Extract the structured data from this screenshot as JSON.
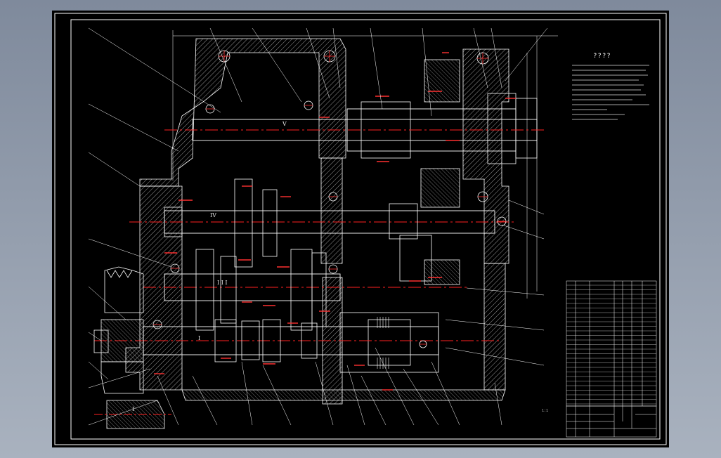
{
  "window": {
    "background": "#8b95a6"
  },
  "drawing": {
    "type": "gearbox-assembly-cross-section",
    "notes_title": "????",
    "shaft_labels": [
      "V",
      "IV",
      "I I I",
      "I",
      "I"
    ],
    "scale_text": "1:1",
    "colors": {
      "background": "#000000",
      "outline": "#ffffff",
      "centerline": "#ff2020",
      "accent": "#ff3030"
    }
  }
}
